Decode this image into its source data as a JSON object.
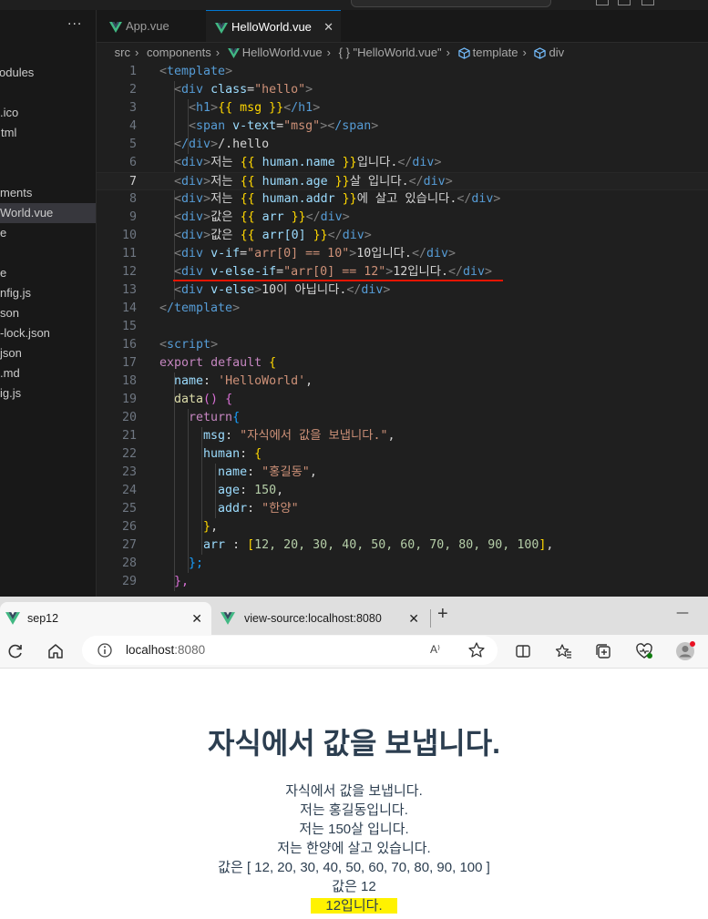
{
  "explorer": {
    "more": "···",
    "items": [
      "odules",
      ".ico",
      "tml",
      "ments",
      "World.vue",
      "e",
      "e",
      "nfig.js",
      "son",
      "-lock.json",
      "json",
      ".md",
      "ig.js"
    ]
  },
  "editor_tabs": [
    {
      "label": "App.vue",
      "close": ""
    },
    {
      "label": "HelloWorld.vue",
      "close": "✕"
    }
  ],
  "breadcrumb": [
    "src",
    "components",
    "HelloWorld.vue",
    "{ } \"HelloWorld.vue\"",
    "template",
    "div"
  ],
  "code_lines": [
    "1",
    "2",
    "3",
    "4",
    "5",
    "6",
    "7",
    "8",
    "9",
    "10",
    "11",
    "12",
    "13",
    "14",
    "15",
    "16",
    "17",
    "18",
    "19",
    "20",
    "21",
    "22",
    "23",
    "24",
    "25",
    "26",
    "27",
    "28",
    "29"
  ],
  "code": {
    "l1_tag": "template",
    "l2_tag": "div",
    "l2_attr": "class",
    "l2_val": "\"hello\"",
    "l3_open": "h1",
    "l3_mus": "{{ msg }}",
    "l3_close": "/h1",
    "l4_tag": "span",
    "l4_attr": "v-text",
    "l4_val": "\"msg\"",
    "l4_close": "/span",
    "l5_close": "/div",
    "l5_text": "/.hello",
    "l6_text": "저는 ",
    "l6_mus_o": "{{ ",
    "l6_var": "human.name",
    "l6_mus_c": " }}",
    "l6_tail": "입니다.",
    "l7_text": "저는 ",
    "l7_mus_o": "{{ ",
    "l7_var": "human.age",
    "l7_mus_c": " }}",
    "l7_tail": "살 입니다.",
    "l8_text": "저는 ",
    "l8_mus_o": "{{ ",
    "l8_var": "human.addr",
    "l8_mus_c": " }}",
    "l8_tail": "에 살고 있습니다.",
    "l9_text": "값은 ",
    "l9_mus_o": "{{ ",
    "l9_var": "arr",
    "l9_mus_c": " }}",
    "l10_text": "값은 ",
    "l10_mus_o": "{{ ",
    "l10_var": "arr[0]",
    "l10_mus_c": " }}",
    "l11_attr": "v-if",
    "l11_val": "\"arr[0] == 10\"",
    "l11_tail": "10입니다.",
    "l12_attr": "v-else-if",
    "l12_val": "\"arr[0] == 12\"",
    "l12_tail": "12입니다.",
    "l13_attr": "v-else",
    "l13_tail": "10이 아닙니다.",
    "l14_close": "/template",
    "l16_tag": "script",
    "l17_kw": "export",
    "l17_kw2": "default",
    "l17_b": "{",
    "l18_key": "name",
    "l18_val": "'HelloWorld'",
    "l19_fn": "data",
    "l19_p": "()",
    "l19_b": "{",
    "l20_kw": "return",
    "l20_b": "{",
    "l21_key": "msg",
    "l21_val": "\"자식에서 값을 보냅니다.\"",
    "l22_key": "human",
    "l22_b": "{",
    "l23_key": "name",
    "l23_val": "\"홍길동\"",
    "l24_key": "age",
    "l24_val": "150",
    "l25_key": "addr",
    "l25_val": "\"한양\"",
    "l26_b": "}",
    "l27_key": "arr",
    "l27_vals": "12, 20, 30, 40, 50, 60, 70, 80, 90, 100",
    "l28_b": "};",
    "l29_b": "},"
  },
  "browser": {
    "tabs": [
      {
        "label": "sep12",
        "close": "✕"
      },
      {
        "label": "view-source:localhost:8080",
        "close": "✕"
      }
    ],
    "new_tab": "+",
    "minimize": "—",
    "url_host": "localhost",
    "url_port": ":8080",
    "read_aloud": "A⁾"
  },
  "page": {
    "title": "자식에서 값을 보냅니다.",
    "lines": [
      "자식에서 값을 보냅니다.",
      "저는 홍길동입니다.",
      "저는 150살 입니다.",
      "저는 한양에 살고 있습니다.",
      "값은 [ 12, 20, 30, 40, 50, 60, 70, 80, 90, 100 ]",
      "값은 12"
    ],
    "highlight": "12입니다."
  },
  "colors": {
    "editor_bg": "#1f1f1f",
    "sidebar_bg": "#181818",
    "accent": "#0078d4",
    "vue_green": "#41b883",
    "highlight": "#fff200",
    "page_text": "#2c3e50",
    "error_squiggle": "#e51400"
  }
}
